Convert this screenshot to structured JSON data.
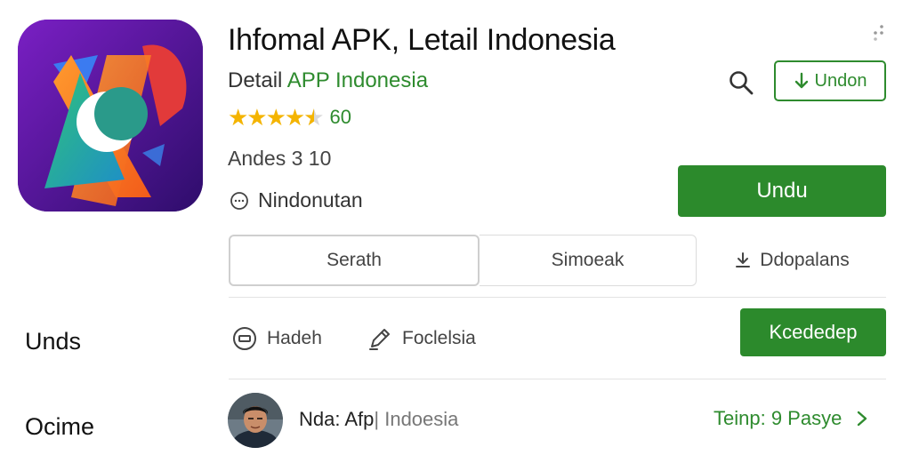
{
  "app": {
    "title": "Ihfomal APK, Letail Indonesia",
    "subtitle_prefix": "Detail ",
    "subtitle_accent": "APP Indonesia",
    "rating_stars": 4.5,
    "rating_value": "60",
    "version": "Andes 3 10",
    "downloads": "Nindonutan",
    "icon": "app-logo-icon"
  },
  "header": {
    "search_icon": "search-icon",
    "undon_label": "Undon",
    "more_icon": "more-vert-icon"
  },
  "install": {
    "label": "Undu"
  },
  "tabs": [
    {
      "label": "Serath"
    },
    {
      "label": "Simoeak"
    },
    {
      "label": "Ddopalans",
      "icon": "download-icon"
    }
  ],
  "sections": {
    "first_label": "Unds",
    "second_label": "Ocime"
  },
  "actions": [
    {
      "label": "Hadeh",
      "icon": "tag-icon"
    },
    {
      "label": "Foclelsia",
      "icon": "pen-icon"
    }
  ],
  "secondary_button": {
    "label": "Kcededep"
  },
  "developer": {
    "name_prefix": "Nda: Afp",
    "name_suffix": "| Indoesia",
    "link": "Teinp: 9 Pasye",
    "avatar": "avatar-photo"
  },
  "colors": {
    "accent_green": "#2c8a2c",
    "star_yellow": "#f4b400",
    "icon_bg": "#5a1aa0"
  }
}
